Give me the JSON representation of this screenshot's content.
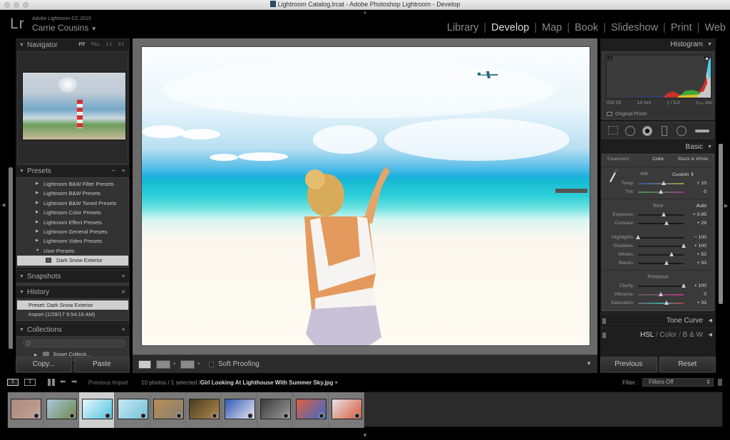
{
  "window": {
    "title": "Lightroom Catalog.lrcat - Adobe Photoshop Lightroom - Develop"
  },
  "identity": {
    "logo": "Lr",
    "app_name": "Adobe Lightroom CC 2015",
    "user": "Carrie Cousins",
    "user_dropdown": "▼"
  },
  "modules": [
    {
      "label": "Library",
      "active": false
    },
    {
      "label": "Develop",
      "active": true
    },
    {
      "label": "Map",
      "active": false
    },
    {
      "label": "Book",
      "active": false
    },
    {
      "label": "Slideshow",
      "active": false
    },
    {
      "label": "Print",
      "active": false
    },
    {
      "label": "Web",
      "active": false
    }
  ],
  "left_panel": {
    "navigator": {
      "title": "Navigator",
      "zoom_options": [
        "FIT",
        "FILL",
        "1:1",
        "3:1"
      ],
      "active_zoom": "FIT"
    },
    "presets": {
      "title": "Presets",
      "minus": "−",
      "plus": "+",
      "items": [
        {
          "label": "Lightroom B&W Filter Presets",
          "expanded": false
        },
        {
          "label": "Lightroom B&W Presets",
          "expanded": false
        },
        {
          "label": "Lightroom B&W Toned Presets",
          "expanded": false
        },
        {
          "label": "Lightroom Color Presets",
          "expanded": false
        },
        {
          "label": "Lightroom Effect Presets",
          "expanded": false
        },
        {
          "label": "Lightroom General Presets",
          "expanded": false
        },
        {
          "label": "Lightroom Video Presets",
          "expanded": false
        },
        {
          "label": "User Presets",
          "expanded": true
        }
      ],
      "selected_item": "Dark Snow Exterior"
    },
    "snapshots": {
      "title": "Snapshots",
      "plus": "+"
    },
    "history": {
      "title": "History",
      "close": "×",
      "items": [
        {
          "label": "Preset: Dark Snow Exterior",
          "selected": true
        },
        {
          "label": "Import (1/28/17 9:54:16 AM)",
          "selected": false
        }
      ]
    },
    "collections": {
      "title": "Collections",
      "plus": "+",
      "search_placeholder": "",
      "items": [
        {
          "label": "Smart Collecti..."
        }
      ]
    },
    "copy_label": "Copy...",
    "paste_label": "Paste"
  },
  "toolbar": {
    "soft_proofing_label": "Soft Proofing",
    "soft_proofing_checked": false
  },
  "right_panel": {
    "histogram": {
      "title": "Histogram",
      "iso": "ISO 50",
      "focal": "14 mm",
      "aperture": "ƒ / 5.0",
      "shutter": "¹⁄₆₄₀ sec",
      "original_photo_label": "Original Photo"
    },
    "basic": {
      "title": "Basic",
      "treatment_label": "Treatment :",
      "treatment_color": "Color",
      "treatment_bw": "Black & White",
      "wb_label": "WB :",
      "wb_value": "Custom",
      "tone_label": "Tone",
      "auto_label": "Auto",
      "presence_label": "Presence",
      "sliders": {
        "temp": {
          "label": "Temp",
          "value": "+ 10",
          "position": 0.56
        },
        "tint": {
          "label": "Tint",
          "value": "0",
          "position": 0.5
        },
        "exposure": {
          "label": "Exposure",
          "value": "+ 0.95",
          "position": 0.56
        },
        "contrast": {
          "label": "Contrast",
          "value": "+ 29",
          "position": 0.62
        },
        "highlights": {
          "label": "Highlights",
          "value": "− 100",
          "position": 0.0
        },
        "shadows": {
          "label": "Shadows",
          "value": "+ 100",
          "position": 1.0
        },
        "whites": {
          "label": "Whites",
          "value": "+ 52",
          "position": 0.74
        },
        "blacks": {
          "label": "Blacks",
          "value": "+ 33",
          "position": 0.63
        },
        "clarity": {
          "label": "Clarity",
          "value": "+ 100",
          "position": 1.0
        },
        "vibrance": {
          "label": "Vibrance",
          "value": "0",
          "position": 0.5
        },
        "saturation": {
          "label": "Saturation",
          "value": "+ 33",
          "position": 0.63
        }
      }
    },
    "tone_curve_label": "Tone Curve",
    "hsl_label": "HSL",
    "color_label": "Color",
    "bw_label": "B & W",
    "previous_label": "Previous",
    "reset_label": "Reset"
  },
  "filmstrip": {
    "screen1": "1",
    "screen2": "2",
    "source": "Previous Import",
    "count_text": "10 photos / 1 selected /",
    "filename": "Girl Looking At Lighthouse With Summer Sky.jpg",
    "filter_label": "Filter :",
    "filter_value": "Filters Off",
    "selected_index": 2,
    "thumbnails": [
      {
        "colors": [
          "#a88a7e",
          "#c6a296"
        ]
      },
      {
        "colors": [
          "#a9c6de",
          "#6f8a4a"
        ]
      },
      {
        "colors": [
          "#e9f6fb",
          "#4fc4e4"
        ]
      },
      {
        "colors": [
          "#c9e7f3",
          "#71c3d8"
        ]
      },
      {
        "colors": [
          "#b58d55",
          "#8a8070"
        ]
      },
      {
        "colors": [
          "#4a3a22",
          "#b08a4a"
        ]
      },
      {
        "colors": [
          "#3058b8",
          "#e8e8ee"
        ]
      },
      {
        "colors": [
          "#3a3a3a",
          "#9a9a9a"
        ]
      },
      {
        "colors": [
          "#e0603a",
          "#3a6ad0"
        ]
      },
      {
        "colors": [
          "#e9e2e6",
          "#d65a3a"
        ]
      }
    ]
  }
}
